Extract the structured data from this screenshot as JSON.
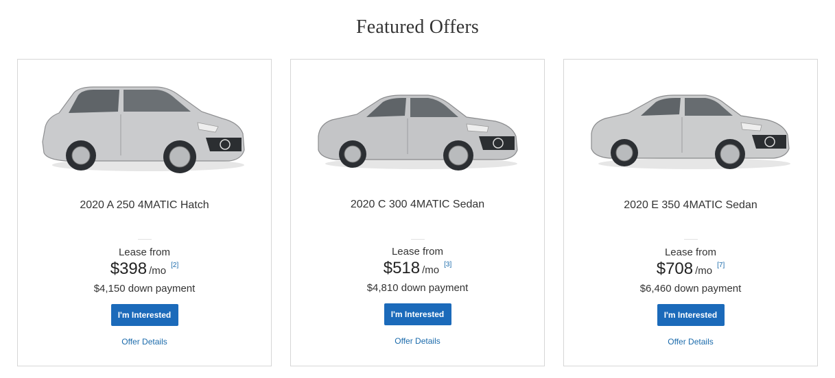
{
  "page": {
    "title": "Featured Offers"
  },
  "offers": [
    {
      "model": "2020 A 250 4MATIC Hatch",
      "lease_label": "Lease from",
      "price": "$398",
      "per": "/mo",
      "footnote": "[2]",
      "down_payment": "$4,150 down payment",
      "cta_label": "I'm Interested",
      "details_label": "Offer Details",
      "image_icon": "hatchback-car-image",
      "body_color": "#c9cacc"
    },
    {
      "model": "2020 C 300 4MATIC Sedan",
      "lease_label": "Lease from",
      "price": "$518",
      "per": "/mo",
      "footnote": "[3]",
      "down_payment": "$4,810 down payment",
      "cta_label": "I'm Interested",
      "details_label": "Offer Details",
      "image_icon": "sedan-car-image",
      "body_color": "#c4c5c7"
    },
    {
      "model": "2020 E 350 4MATIC Sedan",
      "lease_label": "Lease from",
      "price": "$708",
      "per": "/mo",
      "footnote": "[7]",
      "down_payment": "$6,460 down payment",
      "cta_label": "I'm Interested",
      "details_label": "Offer Details",
      "image_icon": "sedan-car-image",
      "body_color": "#cbcccd"
    }
  ],
  "colors": {
    "button": "#1b6aba",
    "link": "#1a6aab",
    "border": "#d6d6d6"
  }
}
